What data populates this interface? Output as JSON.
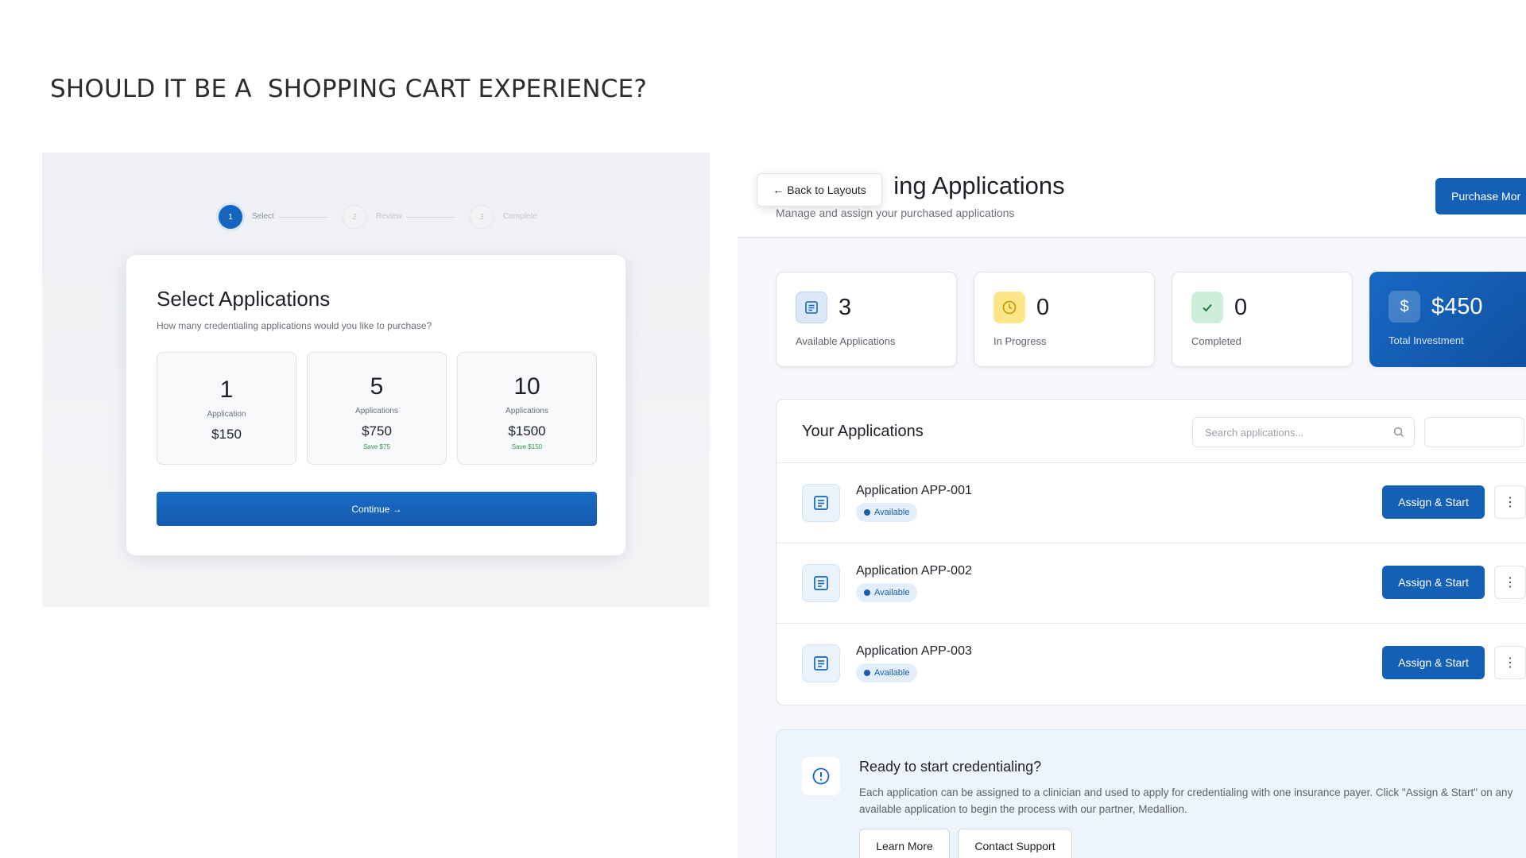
{
  "slide": {
    "title": "SHOULD IT BE A  SHOPPING CART EXPERIENCE?"
  },
  "wizard": {
    "steps": [
      {
        "number": "1",
        "label": "Select"
      },
      {
        "number": "2",
        "label": "Review"
      },
      {
        "number": "3",
        "label": "Complete"
      }
    ],
    "active_step": 1,
    "title": "Select Applications",
    "subtitle": "How many credentialing applications would you like to purchase?",
    "options": [
      {
        "count": "1",
        "unit": "Application",
        "price": "$150",
        "save": ""
      },
      {
        "count": "5",
        "unit": "Applications",
        "price": "$750",
        "save": "Save $75"
      },
      {
        "count": "10",
        "unit": "Applications",
        "price": "$1500",
        "save": "Save $150"
      }
    ],
    "continue_label": "Continue →"
  },
  "dashboard": {
    "back_label": "Back to Layouts",
    "title_visible": "ing Applications",
    "subtitle": "Manage and assign your purchased applications",
    "purchase_label": "Purchase Mor",
    "stats": [
      {
        "value": "3",
        "label": "Available Applications",
        "icon": "document-list-icon",
        "color": "#1565c0"
      },
      {
        "value": "0",
        "label": "In Progress",
        "icon": "clock-icon",
        "color": "#d4a106"
      },
      {
        "value": "0",
        "label": "Completed",
        "icon": "check-icon",
        "color": "#2e9a4a"
      },
      {
        "value": "$450",
        "label": "Total Investment",
        "icon": "dollar-icon",
        "color": "#1868c4"
      }
    ],
    "apps": {
      "title": "Your Applications",
      "search_placeholder": "Search applications...",
      "items": [
        {
          "name": "Application APP-001",
          "status": "Available",
          "action": "Assign & Start"
        },
        {
          "name": "Application APP-002",
          "status": "Available",
          "action": "Assign & Start"
        },
        {
          "name": "Application APP-003",
          "status": "Available",
          "action": "Assign & Start"
        }
      ]
    },
    "ready": {
      "title": "Ready to start credentialing?",
      "text": "Each application can be assigned to a clinician and used to apply for credentialing with one insurance payer. Click \"Assign & Start\" on any available application to begin the process with our partner, Medallion.",
      "learn_more": "Learn More",
      "contact_support": "Contact Support"
    }
  }
}
